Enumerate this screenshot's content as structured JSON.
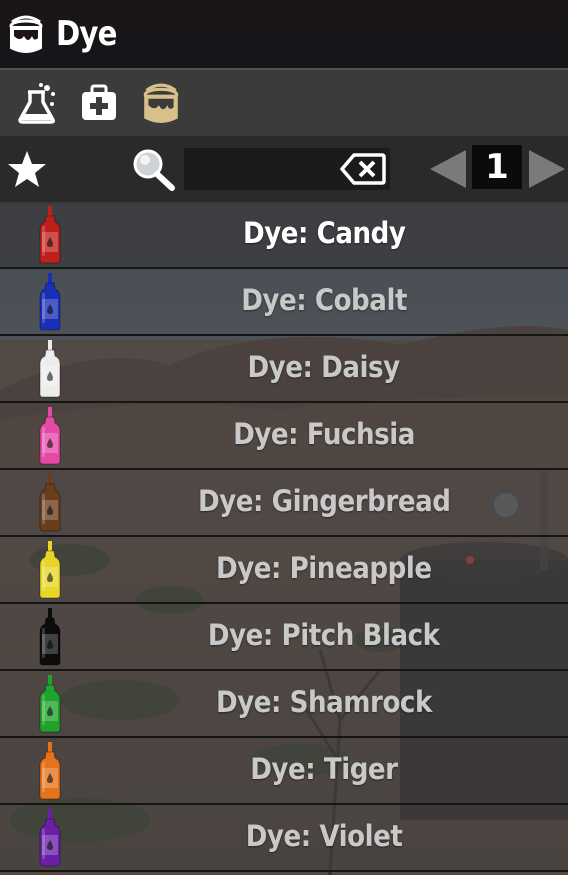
{
  "window": {
    "title": "Dye",
    "title_icon": "paint-bucket-icon"
  },
  "tabs": [
    {
      "name": "chemistry",
      "icon": "flask-icon",
      "active": false
    },
    {
      "name": "medical",
      "icon": "first-aid-kit-icon",
      "active": false
    },
    {
      "name": "dye",
      "icon": "paint-bucket-icon",
      "active": true
    }
  ],
  "toolbar": {
    "favorite_icon": "star-icon",
    "search_icon": "magnifier-icon",
    "search_value": "",
    "clear_icon": "backspace-icon",
    "page_number": "1"
  },
  "items": [
    {
      "label": "Dye: Candy",
      "color": "#c0201c",
      "selected": true
    },
    {
      "label": "Dye: Cobalt",
      "color": "#1a2fb8",
      "selected": false
    },
    {
      "label": "Dye: Daisy",
      "color": "#ececec",
      "selected": false
    },
    {
      "label": "Dye: Fuchsia",
      "color": "#e54aa8",
      "selected": false
    },
    {
      "label": "Dye: Gingerbread",
      "color": "#6a3d1c",
      "selected": false
    },
    {
      "label": "Dye: Pineapple",
      "color": "#e8d52a",
      "selected": false
    },
    {
      "label": "Dye: Pitch Black",
      "color": "#0c0c0c",
      "selected": false
    },
    {
      "label": "Dye: Shamrock",
      "color": "#1fa32a",
      "selected": false
    },
    {
      "label": "Dye: Tiger",
      "color": "#e6731c",
      "selected": false
    },
    {
      "label": "Dye: Violet",
      "color": "#6a1fa8",
      "selected": false
    }
  ],
  "colors": {
    "title_bg": "#1b1517",
    "tab_active": "#d8c08a",
    "text_selected": "#ffffff",
    "text_normal": "#c9c9c9"
  }
}
